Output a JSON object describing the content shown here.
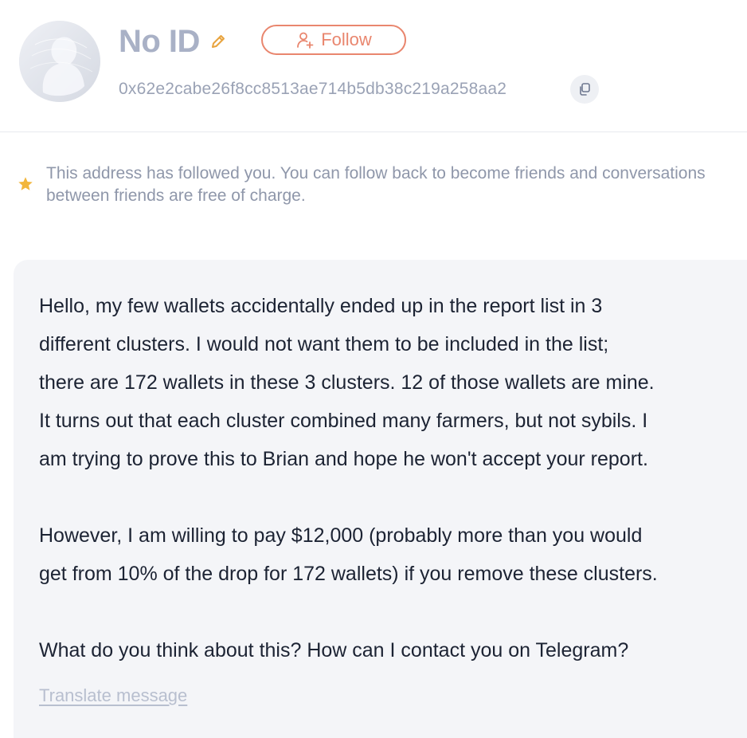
{
  "profile": {
    "name": "No ID",
    "address": "0x62e2cabe26f8cc8513ae714b5db38c219a258aa2",
    "follow_label": "Follow",
    "icons": {
      "avatar": "avatar-placeholder",
      "edit": "pencil-icon",
      "follow": "add-user-icon",
      "copy": "copy-icon"
    }
  },
  "notice": {
    "icon": "star-icon",
    "line1": "This address has followed you. You can follow back to become friends and conversations",
    "line2": "between friends are free of charge."
  },
  "message": {
    "lines_p1": [
      "Hello, my few wallets accidentally ended up in the report list in 3",
      "different clusters. I would not want them to be included in the list;",
      "there are 172 wallets in these 3 clusters. 12 of those wallets are mine.",
      "It turns out that each cluster combined many farmers, but not sybils. I",
      "am trying to prove this to Brian and hope he won't accept your report."
    ],
    "lines_p2": [
      "However, I am willing to pay $12,000 (probably more than you would",
      "get from 10% of the drop for 172 wallets) if you remove these clusters."
    ],
    "lines_p3": [
      "What do you think about this? How can I contact you on Telegram?"
    ],
    "translate_label": "Translate message"
  },
  "colors": {
    "accent": "#e9866e",
    "name": "#a9b1c6",
    "muted": "#8f97aa",
    "bubble": "#f4f5f8",
    "star": "#f2b63c",
    "text": "#1c2333"
  }
}
